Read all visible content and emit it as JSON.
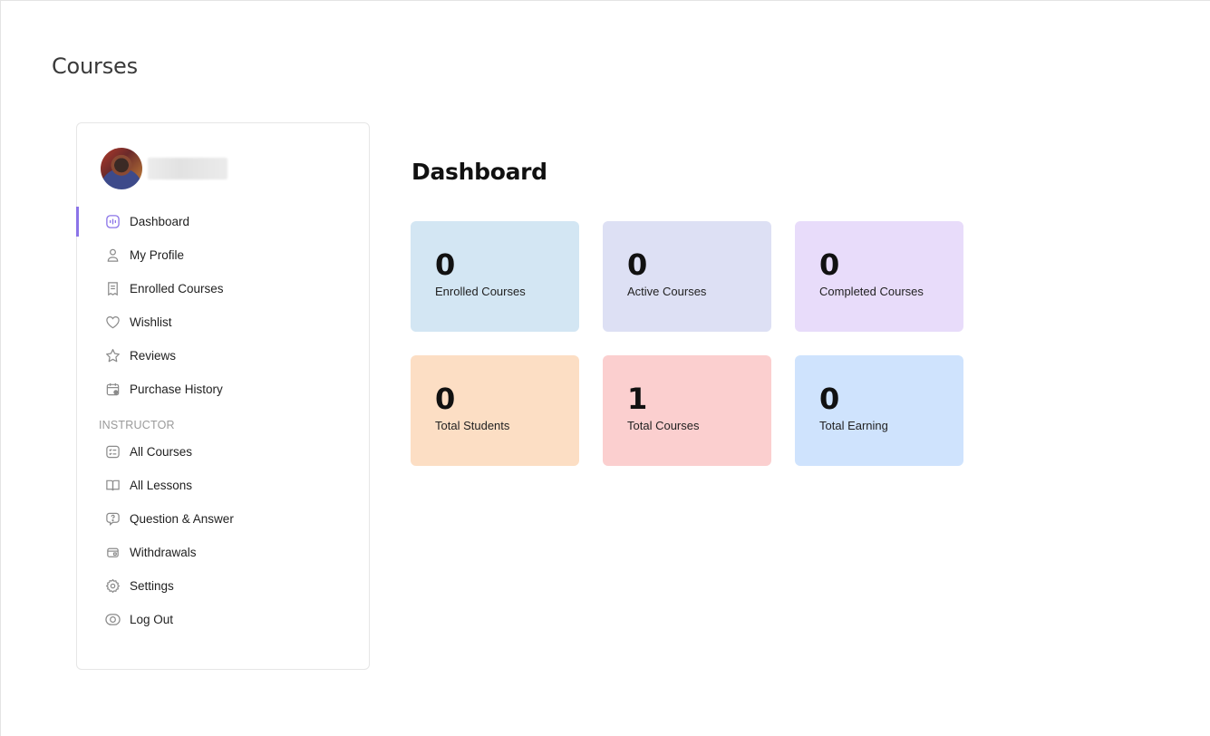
{
  "page": {
    "title": "Courses"
  },
  "sidebar": {
    "user": {
      "avatar": "user-avatar-photo",
      "name_hidden": true
    },
    "items": [
      {
        "label": "Dashboard",
        "icon": "dashboard-icon",
        "active": true
      },
      {
        "label": "My Profile",
        "icon": "user-icon"
      },
      {
        "label": "Enrolled Courses",
        "icon": "receipt-icon"
      },
      {
        "label": "Wishlist",
        "icon": "heart-icon"
      },
      {
        "label": "Reviews",
        "icon": "star-icon"
      },
      {
        "label": "Purchase History",
        "icon": "calendar-icon"
      }
    ],
    "instructor_label": "INSTRUCTOR",
    "instructor_items": [
      {
        "label": "All Courses",
        "icon": "checklist-icon"
      },
      {
        "label": "All Lessons",
        "icon": "book-icon"
      },
      {
        "label": "Question & Answer",
        "icon": "question-bubble-icon"
      },
      {
        "label": "Withdrawals",
        "icon": "wallet-icon"
      },
      {
        "label": "Settings",
        "icon": "gear-icon"
      },
      {
        "label": "Log Out",
        "icon": "logout-icon"
      }
    ]
  },
  "main": {
    "title": "Dashboard",
    "cards": [
      {
        "value": "0",
        "label": "Enrolled Courses",
        "color": "#d3e6f3"
      },
      {
        "value": "0",
        "label": "Active Courses",
        "color": "#dde0f4"
      },
      {
        "value": "0",
        "label": "Completed Courses",
        "color": "#e8dcfa"
      },
      {
        "value": "0",
        "label": "Total Students",
        "color": "#fcdec4"
      },
      {
        "value": "1",
        "label": "Total Courses",
        "color": "#fbcfcf"
      },
      {
        "value": "0",
        "label": "Total Earning",
        "color": "#cfe3fd"
      }
    ]
  },
  "colors": {
    "accent": "#8b74e8"
  }
}
